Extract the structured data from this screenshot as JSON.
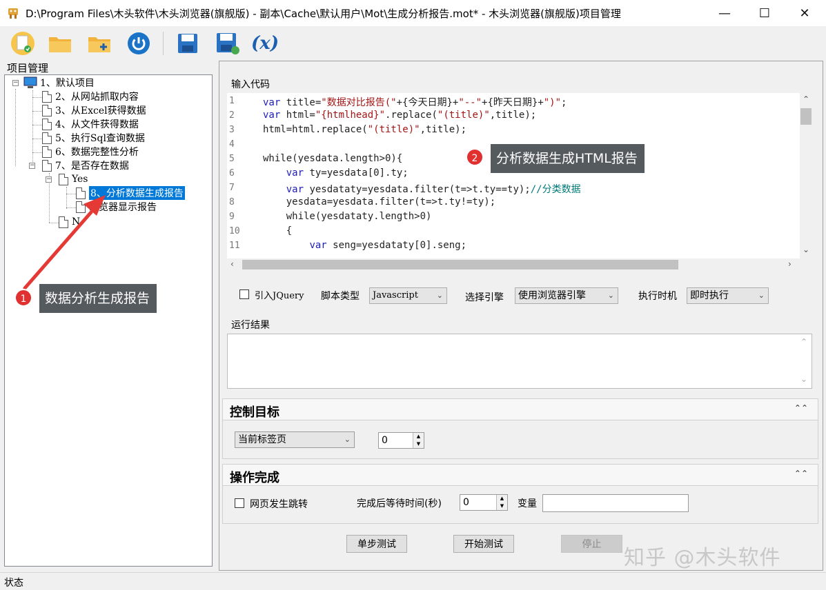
{
  "window": {
    "title": "D:\\Program Files\\木头软件\\木头浏览器(旗舰版) - 副本\\Cache\\默认用户\\Mot\\生成分析报告.mot* - 木头浏览器(旗舰版)项目管理",
    "minimize": "—",
    "maximize": "☐",
    "close": "✕"
  },
  "toolbar": {
    "items": [
      "new-file-icon",
      "open-folder-icon",
      "add-folder-icon",
      "power-icon",
      "save-icon",
      "save-as-icon",
      "variable-icon"
    ],
    "variable_label": "(x)"
  },
  "project": {
    "label": "项目管理",
    "tree": [
      {
        "label": "1、默认项目"
      },
      {
        "label": "2、从网站抓取内容"
      },
      {
        "label": "3、从Excel获得数据"
      },
      {
        "label": "4、从文件获得数据"
      },
      {
        "label": "5、执行Sql查询数据"
      },
      {
        "label": "6、数据完整性分析"
      },
      {
        "label": "7、是否存在数据"
      },
      {
        "label": "Yes"
      },
      {
        "label": "8、分析数据生成报告"
      },
      {
        "label": "浏览器显示报告"
      },
      {
        "label": "N"
      }
    ]
  },
  "code": {
    "label": "输入代码",
    "line_numbers": [
      "1",
      "2",
      "3",
      "4",
      "5",
      "6",
      "7",
      "8",
      "9",
      "10",
      "11"
    ]
  },
  "options": {
    "jquery_label": "引入JQuery",
    "script_type_label": "脚本类型",
    "script_type_value": "Javascript",
    "engine_label": "选择引擎",
    "engine_value": "使用浏览器引擎",
    "timing_label": "执行时机",
    "timing_value": "即时执行"
  },
  "result": {
    "label": "运行结果"
  },
  "control": {
    "title": "控制目标",
    "target_value": "当前标签页",
    "index_value": "0"
  },
  "complete": {
    "title": "操作完成",
    "redirect_label": "网页发生跳转",
    "wait_label": "完成后等待时间(秒)",
    "wait_value": "0",
    "variable_label": "变量"
  },
  "buttons": {
    "step": "单步测试",
    "start": "开始测试",
    "stop": "停止"
  },
  "status": {
    "text": "状态"
  },
  "annotations": {
    "badge1": "1",
    "callout1": "数据分析生成报告",
    "badge2": "2",
    "callout2": "分析数据生成HTML报告"
  },
  "watermark": "知乎 @木头软件",
  "colors": {
    "accent": "#0078d7",
    "callout": "#555a5f",
    "badge": "#e03030"
  }
}
